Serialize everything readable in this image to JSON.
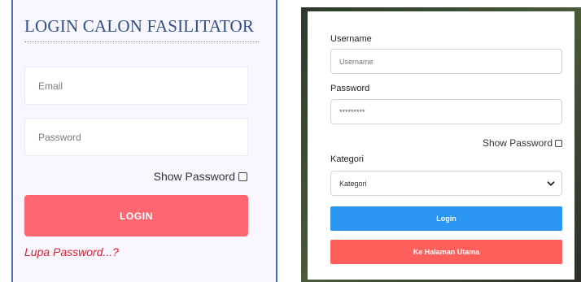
{
  "left": {
    "title": "LOGIN CALON FASILITATOR",
    "email_placeholder": "Email",
    "password_placeholder": "Password",
    "show_password_label": "Show Password",
    "login_label": "LOGIN",
    "forgot_label": "Lupa Password...?"
  },
  "right": {
    "username_label": "Username",
    "username_placeholder": "Username",
    "password_label": "Password",
    "password_value": "*********",
    "show_password_label": "Show Password",
    "kategori_label": "Kategori",
    "kategori_selected": "Kategori",
    "login_label": "Login",
    "home_label": "Ke Halaman Utama"
  },
  "colors": {
    "left_title": "#2d4f8a",
    "left_login_bg": "#ff6670",
    "forgot_text": "#e0202e",
    "right_login_bg": "#2b96f2",
    "right_home_bg": "#ff5e5b"
  }
}
